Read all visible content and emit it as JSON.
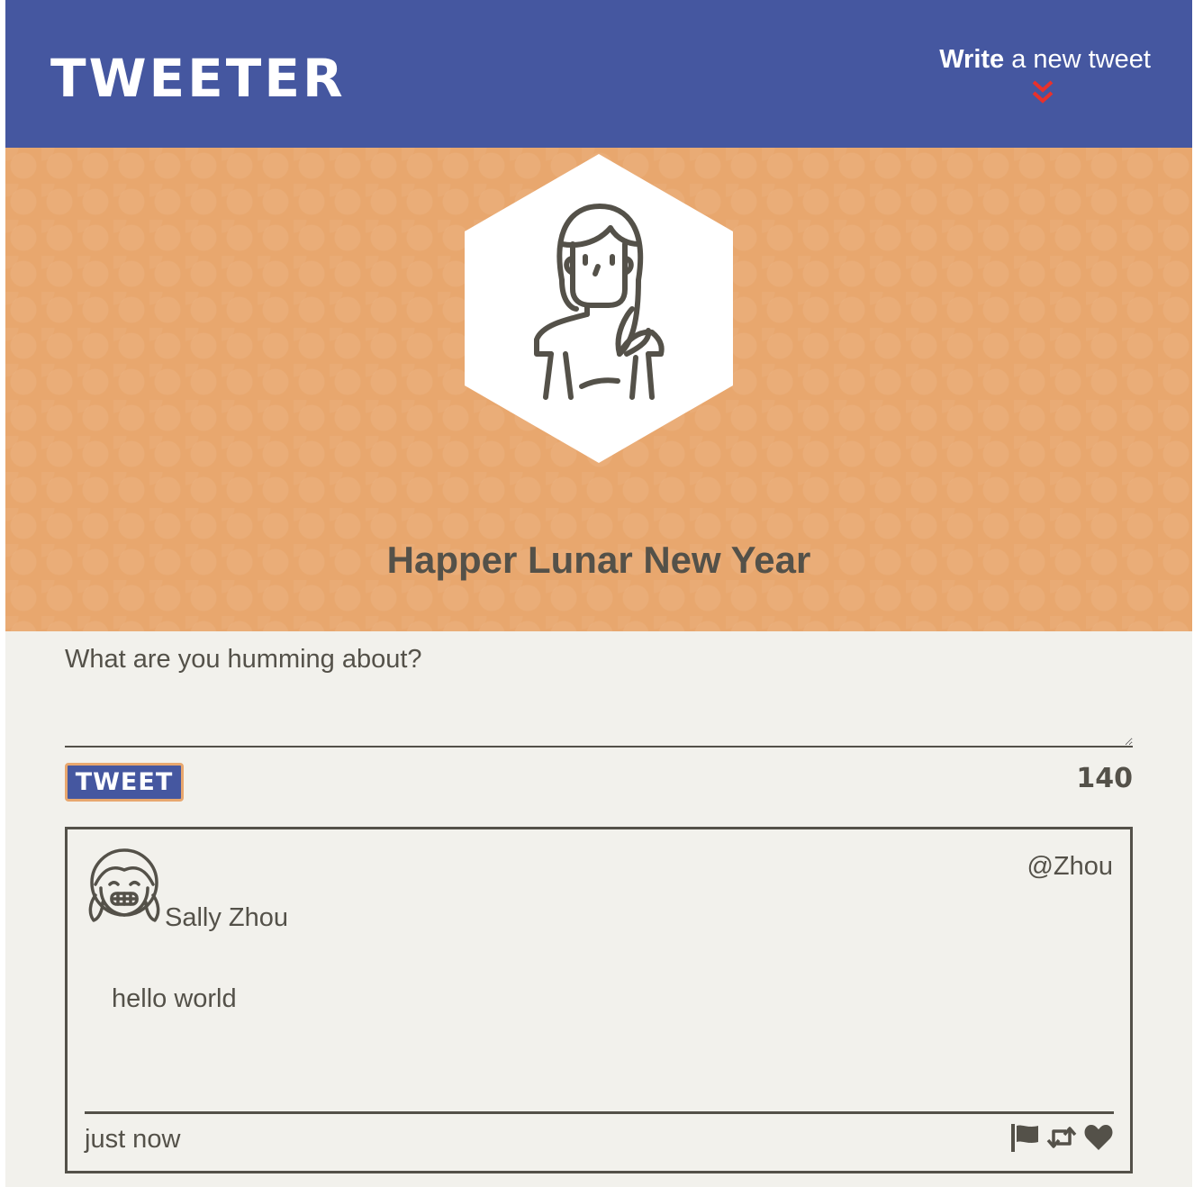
{
  "nav": {
    "brand": "TWEETER",
    "compose_bold": "Write",
    "compose_rest": " a new tweet",
    "compose_icon": "double-chevron-down-icon"
  },
  "profile": {
    "avatar_icon": "woman-avatar-icon",
    "name": "Happer Lunar New Year"
  },
  "composer": {
    "placeholder": "What are you humming about?",
    "value": "",
    "submit_label": "TWEET",
    "counter": "140"
  },
  "tweets": [
    {
      "avatar_icon": "smiling-girl-avatar-icon",
      "name": "Sally Zhou",
      "handle": "@Zhou",
      "content": "hello world",
      "time": "just now",
      "actions": [
        "flag-icon",
        "retweet-icon",
        "heart-icon"
      ]
    }
  ],
  "colors": {
    "nav": "#4557a0",
    "header": "#e8a76e",
    "background": "#f2f1ec",
    "text": "#545149",
    "chevron": "#e8312c"
  }
}
